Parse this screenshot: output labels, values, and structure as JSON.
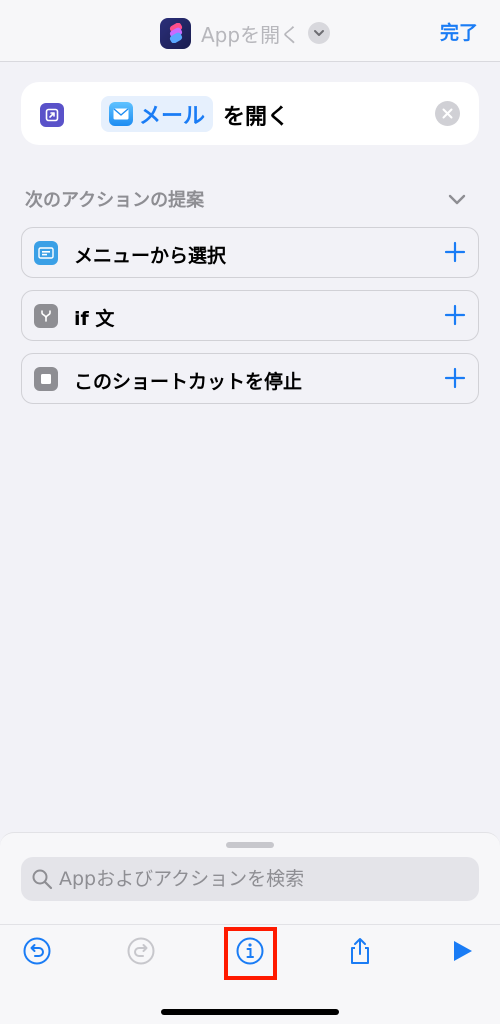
{
  "navbar": {
    "title": "Appを開く",
    "done_label": "完了",
    "app_icon": "shortcuts-icon",
    "chevron_icon": "chevron-down-icon"
  },
  "action": {
    "app_name": "メール",
    "verb": "を開く",
    "action_icon": "open-app-icon",
    "app_icon": "mail-icon",
    "clear_icon": "clear-icon"
  },
  "suggestions": {
    "header": "次のアクションの提案",
    "items": [
      {
        "label": "メニューから選択",
        "icon": "menu-icon",
        "icon_color": "#3aa0e6"
      },
      {
        "label": "if 文",
        "icon": "branch-icon",
        "icon_color": "#8e8e93"
      },
      {
        "label": "このショートカットを停止",
        "icon": "stop-icon",
        "icon_color": "#8e8e93"
      }
    ]
  },
  "search": {
    "placeholder": "Appおよびアクションを検索",
    "value": ""
  },
  "toolbar": {
    "undo_icon": "undo-icon",
    "redo_icon": "redo-icon",
    "info_icon": "info-icon",
    "share_icon": "share-icon",
    "play_icon": "play-icon",
    "highlighted": "info-button"
  },
  "colors": {
    "accent": "#1a7cf5",
    "highlight": "#ff1a00",
    "background": "#f2f2f7"
  }
}
